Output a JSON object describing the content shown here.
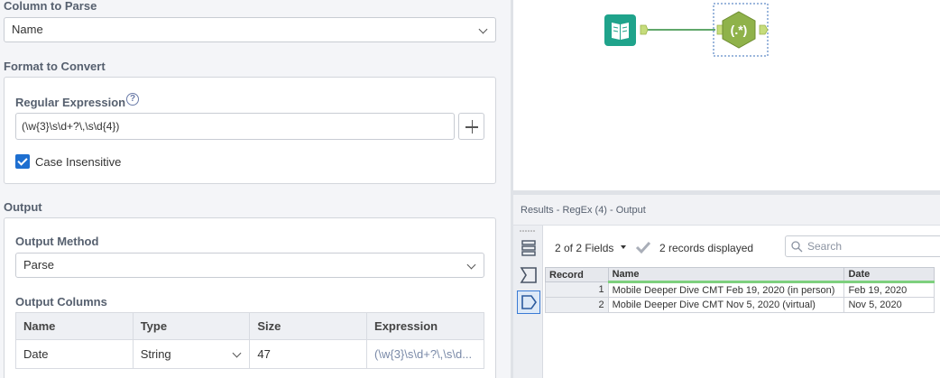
{
  "config": {
    "column_to_parse": {
      "title": "Column to Parse",
      "value": "Name"
    },
    "format_to_convert": {
      "title": "Format to Convert"
    },
    "regular_expression": {
      "label": "Regular Expression",
      "value": "(\\w{3}\\s\\d+?\\,\\s\\d{4})",
      "help_icon": "?"
    },
    "case_insensitive": {
      "label": "Case Insensitive",
      "checked": true
    },
    "output": {
      "title": "Output",
      "method_label": "Output Method",
      "method_value": "Parse",
      "columns_label": "Output Columns",
      "columns_headers": [
        "Name",
        "Type",
        "Size",
        "Expression"
      ],
      "columns_rows": [
        {
          "name": "Date",
          "type": "String",
          "size": "47",
          "expression": "(\\w{3}\\s\\d+?\\,\\s\\d..."
        }
      ]
    }
  },
  "canvas": {
    "tools": [
      {
        "name": "Input Data",
        "icon": "book-icon",
        "color": "#1fa38b"
      },
      {
        "name": "RegEx",
        "icon": "regex-icon",
        "label": "(.*)",
        "color": "#8fb24a"
      }
    ]
  },
  "results": {
    "title": "Results - RegEx (4) - Output",
    "fields_selector": "2 of 2 Fields",
    "records_count": "2 records displayed",
    "search_placeholder": "Search",
    "headers": [
      "Record",
      "Name",
      "Date"
    ],
    "rows": [
      {
        "record": "1",
        "name": "Mobile Deeper Dive CMT Feb 19, 2020 (in person)",
        "date": "Feb 19, 2020"
      },
      {
        "record": "2",
        "name": "Mobile Deeper Dive CMT Nov 5, 2020 (virtual)",
        "date": "Nov 5, 2020"
      }
    ]
  },
  "colors": {
    "accent_blue": "#1e6fd0",
    "green_highlight": "#7ed07e"
  }
}
